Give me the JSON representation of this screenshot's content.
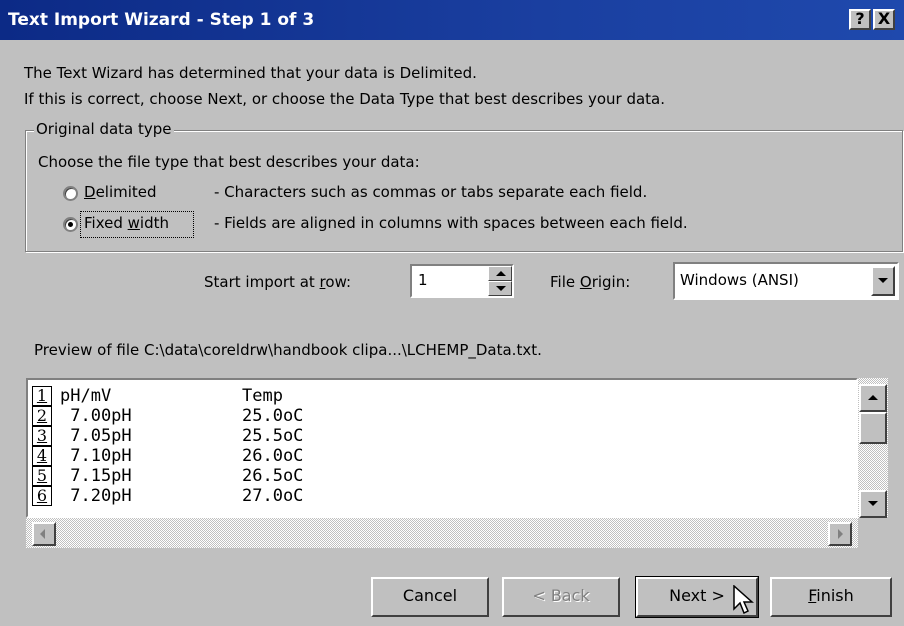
{
  "window": {
    "title": "Text Import Wizard - Step 1 of 3",
    "help_button": "?",
    "close_button": "X"
  },
  "intro": {
    "line1": "The Text Wizard has determined that your data is Delimited.",
    "line2": "If this is correct, choose Next, or choose the Data Type that best describes your data."
  },
  "original_data_type": {
    "legend": "Original data type",
    "prompt": "Choose the file type that best describes your data:",
    "options": [
      {
        "label_pre": "",
        "label_u": "D",
        "label_post": "elimited",
        "description": "- Characters such as commas or tabs separate each field.",
        "selected": false
      },
      {
        "label_pre": "Fixed ",
        "label_u": "w",
        "label_post": "idth",
        "description": "- Fields are aligned in columns with spaces between each field.",
        "selected": true
      }
    ]
  },
  "start_row": {
    "label_pre": "Start import at ",
    "label_u": "r",
    "label_post": "ow:",
    "value": "1"
  },
  "file_origin": {
    "label_pre": "File ",
    "label_u": "O",
    "label_post": "rigin:",
    "value": "Windows (ANSI)"
  },
  "preview": {
    "label": "Preview of file C:\\data\\coreldrw\\handbook clipa...\\LCHEMP_Data.txt.",
    "rows": [
      {
        "num": "1",
        "col1": "pH/mV",
        "col2": "Temp"
      },
      {
        "num": "2",
        "col1": " 7.00pH",
        "col2": "25.0oC"
      },
      {
        "num": "3",
        "col1": " 7.05pH",
        "col2": "25.5oC"
      },
      {
        "num": "4",
        "col1": " 7.10pH",
        "col2": "26.0oC"
      },
      {
        "num": "5",
        "col1": " 7.15pH",
        "col2": "26.5oC"
      },
      {
        "num": "6",
        "col1": " 7.20pH",
        "col2": "27.0oC"
      }
    ]
  },
  "buttons": {
    "cancel": "Cancel",
    "back": "< Back",
    "next": "Next >",
    "finish_u": "F",
    "finish_post": "inish"
  }
}
